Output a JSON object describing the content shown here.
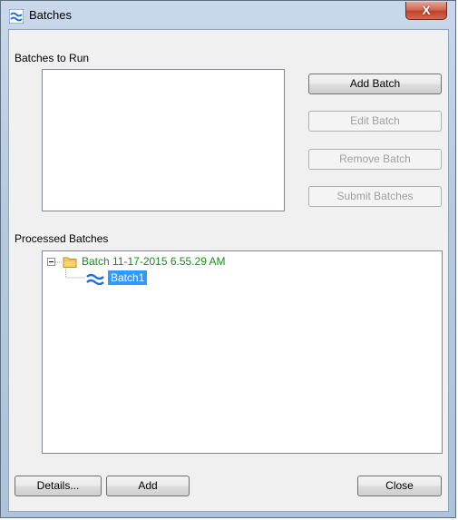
{
  "window": {
    "title": "Batches",
    "close_glyph": "X"
  },
  "batches_to_run": {
    "label": "Batches to Run",
    "items": []
  },
  "buttons": {
    "add_batch": "Add Batch",
    "edit_batch": "Edit Batch",
    "remove_batch": "Remove Batch",
    "submit_batches": "Submit Batches",
    "details": "Details...",
    "add": "Add",
    "close": "Close"
  },
  "processed_batches": {
    "label": "Processed Batches",
    "root": {
      "label": "Batch 11-17-2015 6.55.29 AM",
      "expander": "−",
      "icon": "folder-icon",
      "color": "#1a8a1a",
      "children": [
        {
          "label": "Batch1",
          "icon": "batch-wave-icon",
          "selected": true
        }
      ]
    }
  },
  "colors": {
    "selection": "#3399ff",
    "title_bar": "#b6c9e0",
    "close_button": "#c7432b"
  }
}
